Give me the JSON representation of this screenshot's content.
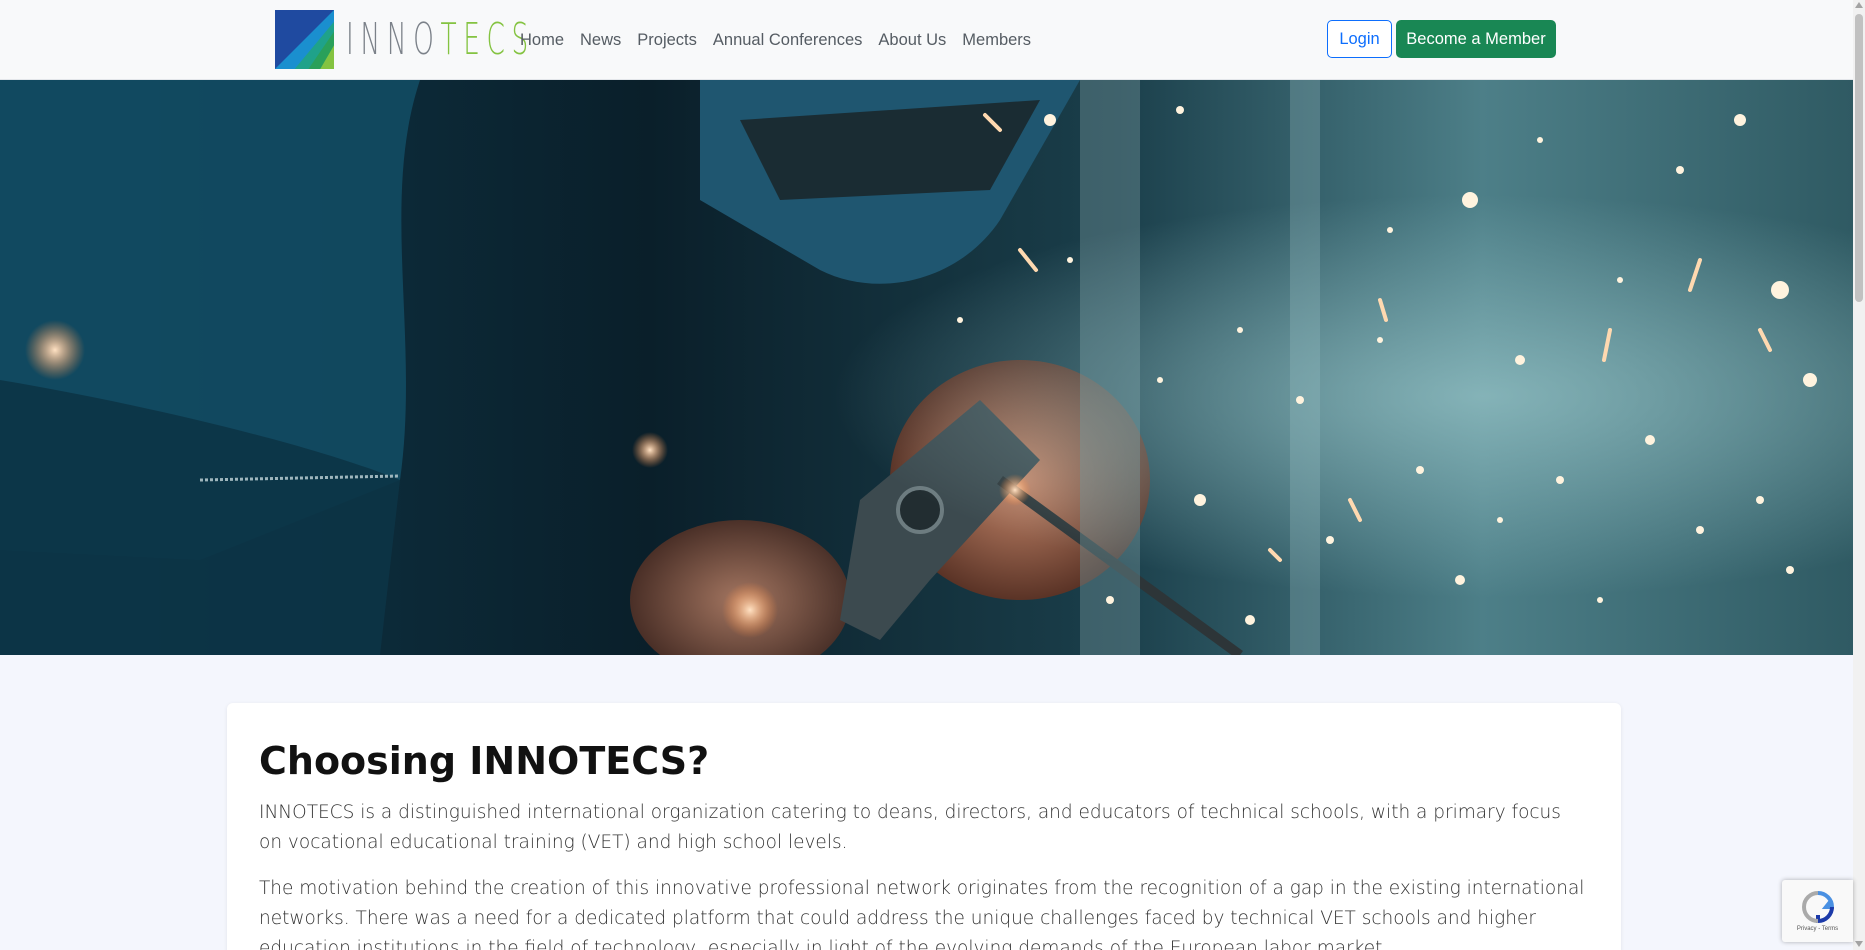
{
  "brand": {
    "name_part1": "INNO",
    "name_part2": "TECS",
    "logo_colors": [
      "#1f4aa0",
      "#1a8fcf",
      "#2aa05a",
      "#84c341"
    ]
  },
  "nav": {
    "items": [
      {
        "label": "Home"
      },
      {
        "label": "News"
      },
      {
        "label": "Projects"
      },
      {
        "label": "Annual Conferences"
      },
      {
        "label": "About Us"
      },
      {
        "label": "Members"
      }
    ],
    "login_label": "Login",
    "become_member_label": "Become a Member"
  },
  "hero": {
    "image": "welder-sparks-photo"
  },
  "main": {
    "heading": "Choosing INNOTECS?",
    "paragraphs": [
      "INNOTECS is a distinguished international organization catering to deans, directors, and educators of technical schools, with a primary focus on vocational educational training (VET) and high school levels.",
      "The motivation behind the creation of this innovative professional network originates from the recognition of a gap in the existing international networks. There was a need for a dedicated platform that could address the unique challenges faced by technical VET schools and higher education institutions in the field of technology, especially in light of the evolving demands of the European labor market."
    ]
  },
  "recaptcha": {
    "footer": "Privacy - Terms"
  },
  "colors": {
    "primary": "#0d6efd",
    "success": "#198754",
    "page_bg": "#f4f6fd",
    "navbar_bg": "#f8f9fa"
  }
}
